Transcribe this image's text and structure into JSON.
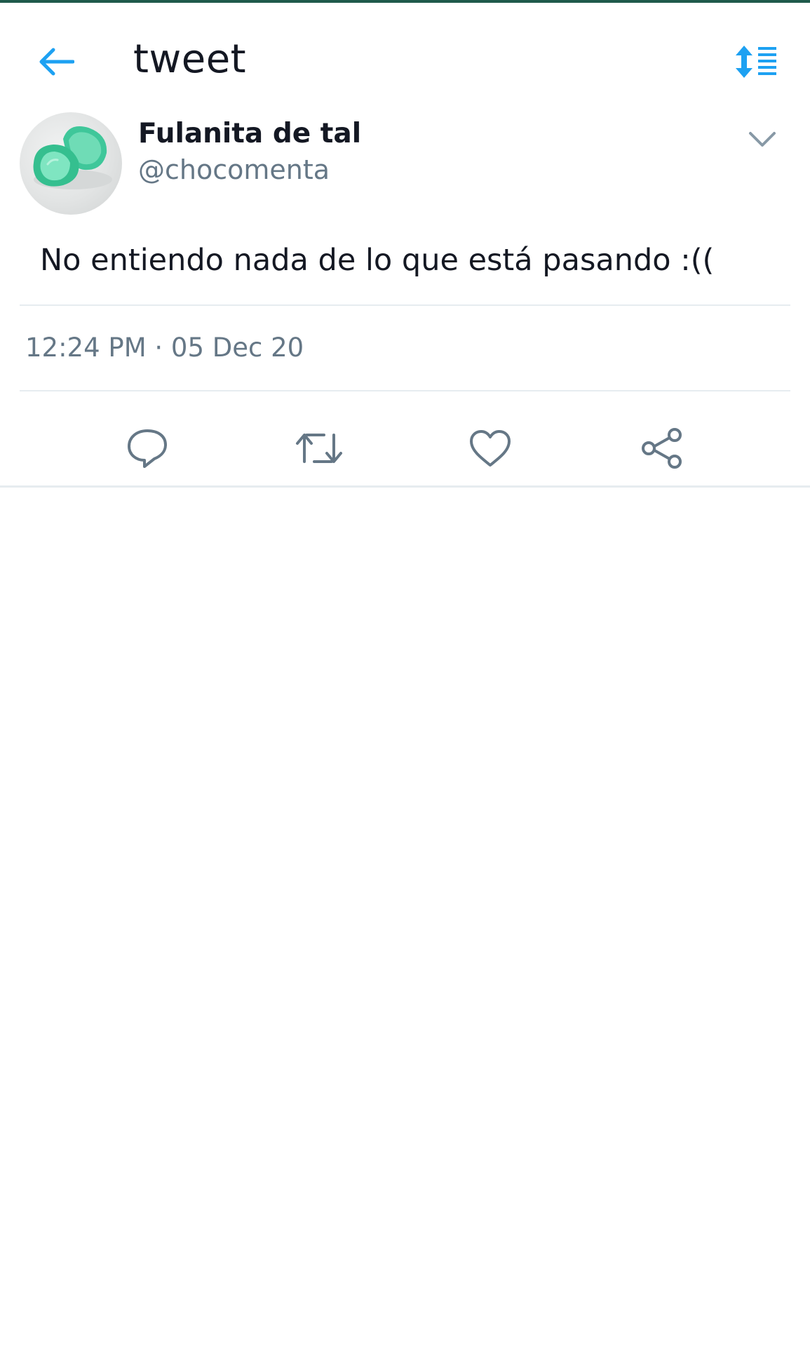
{
  "header": {
    "title": "tweet",
    "back_icon": "arrow-left-icon",
    "sort_icon": "sort-list-icon"
  },
  "tweet": {
    "display_name": "Fulanita de tal",
    "handle": "@chocomenta",
    "text": "No entiendo nada de lo que está pasando :((",
    "timestamp": "12:24 PM · 05 Dec 20",
    "avatar": "mint-lime-candy-avatar"
  },
  "actions": [
    {
      "icon": "reply-icon"
    },
    {
      "icon": "retweet-icon"
    },
    {
      "icon": "like-heart-icon"
    },
    {
      "icon": "share-icon"
    }
  ],
  "colors": {
    "accent": "#1da1f2",
    "text": "#141823",
    "secondary": "#657786",
    "icon_gray": "#657786",
    "divider": "#e6ecf0",
    "status_strip": "#1f5a4b"
  }
}
